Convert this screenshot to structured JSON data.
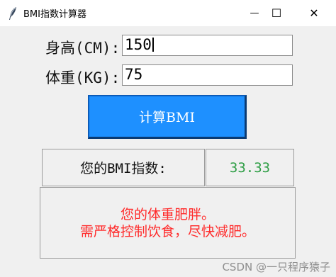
{
  "window": {
    "title": "BMI指数计算器",
    "icon": "feather-icon",
    "minimize_glyph": "—",
    "maximize_glyph": "☐",
    "close_glyph": "✕"
  },
  "form": {
    "height_label": "身高(CM):",
    "height_value": "150",
    "weight_label": "体重(KG):",
    "weight_value": "75"
  },
  "calculate_button": {
    "label": "计算BMI",
    "color": "#1e90ff"
  },
  "result": {
    "label": "您的BMI指数:",
    "value": "33.33",
    "value_color": "#2e9e45"
  },
  "advice": {
    "line1": "您的体重肥胖。",
    "line2": "需严格控制饮食，尽快减肥。",
    "color": "#ff2a2a"
  },
  "watermark": "CSDN @一只程序猿子"
}
